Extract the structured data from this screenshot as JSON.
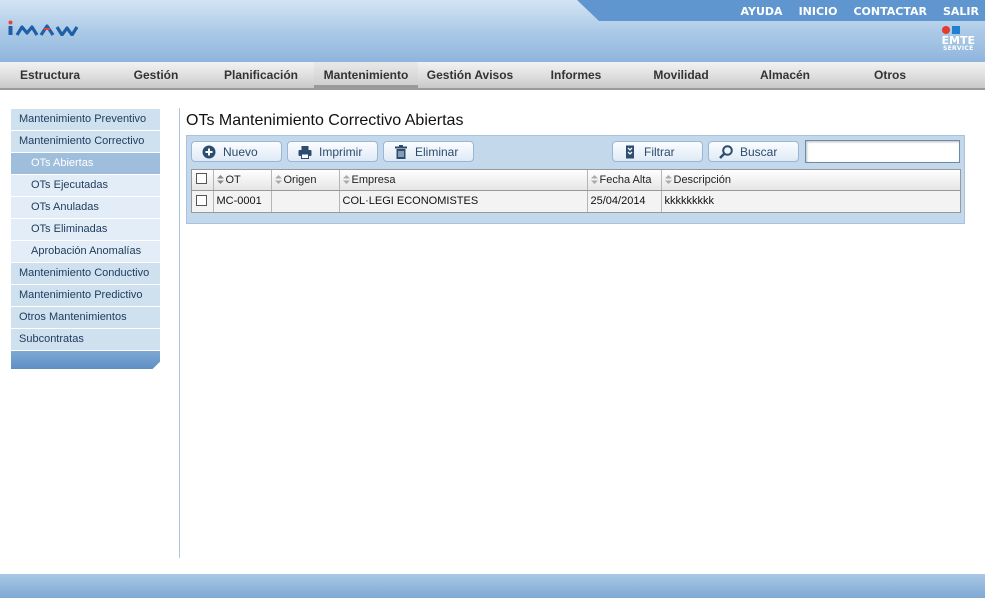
{
  "header": {
    "logo_text": "imaw",
    "top_links": [
      "AYUDA",
      "INICIO",
      "CONTACTAR",
      "SALIR"
    ],
    "partner_logo": {
      "line1": "EMTE",
      "line2": "SERVICE"
    }
  },
  "main_nav": [
    "Estructura",
    "Gestión",
    "Planificación",
    "Mantenimiento",
    "Gestión Avisos",
    "Informes",
    "Movilidad",
    "Almacén",
    "Otros"
  ],
  "main_nav_active": "Mantenimiento",
  "sidebar": {
    "items": [
      {
        "label": "Mantenimiento Preventivo",
        "level": 0
      },
      {
        "label": "Mantenimiento Correctivo",
        "level": 0
      },
      {
        "label": "OTs Abiertas",
        "level": 1,
        "selected": true
      },
      {
        "label": "OTs Ejecutadas",
        "level": 1
      },
      {
        "label": "OTs Anuladas",
        "level": 1
      },
      {
        "label": "OTs Eliminadas",
        "level": 1
      },
      {
        "label": "Aprobación Anomalías",
        "level": 1
      },
      {
        "label": "Mantenimiento Conductivo",
        "level": 0
      },
      {
        "label": "Mantenimiento Predictivo",
        "level": 0
      },
      {
        "label": "Otros Mantenimientos",
        "level": 0
      },
      {
        "label": "Subcontratas",
        "level": 0
      }
    ]
  },
  "page": {
    "title": "OTs Mantenimiento Correctivo Abiertas",
    "toolbar": {
      "new_label": "Nuevo",
      "print_label": "Imprimir",
      "delete_label": "Eliminar",
      "filter_label": "Filtrar",
      "search_label": "Buscar",
      "search_value": ""
    },
    "table": {
      "columns": [
        "OT",
        "Origen",
        "Empresa",
        "Fecha Alta",
        "Descripción"
      ],
      "rows": [
        {
          "ot": "MC-0001",
          "origen": "",
          "empresa": "COL·LEGI ECONOMISTES",
          "fecha_alta": "25/04/2014",
          "descripcion": "kkkkkkkkk"
        }
      ]
    }
  },
  "colors": {
    "header_blue": "#8fb5dd",
    "topbar_blue": "#5f96cf",
    "menu_selected": "#9ebedc",
    "panel_bg": "#c4d8ec"
  }
}
